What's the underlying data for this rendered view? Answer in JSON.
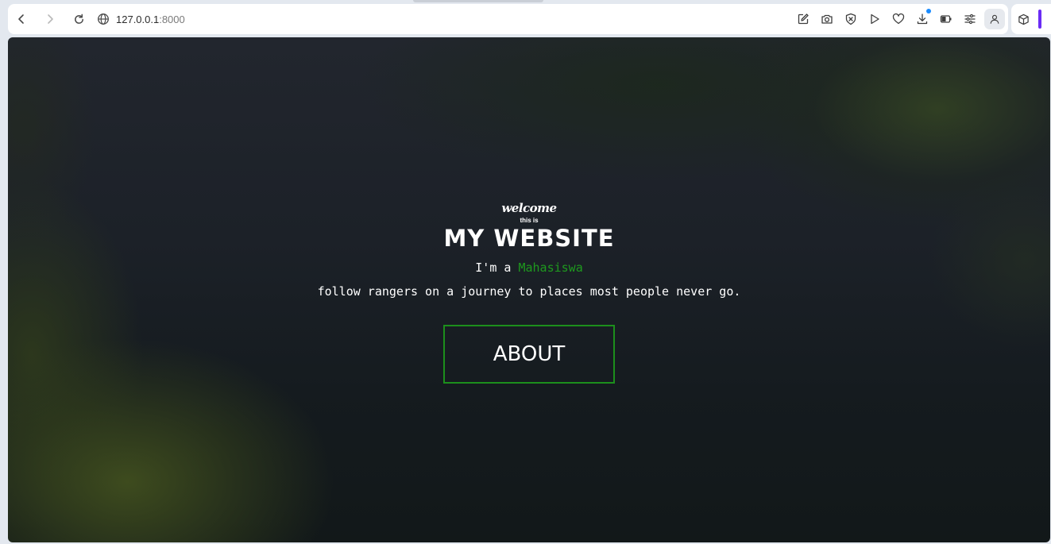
{
  "browser": {
    "url_host": "127.0.0.1",
    "url_port": ":8000",
    "icons": {
      "back": "back-arrow-icon",
      "forward": "forward-arrow-icon",
      "reload": "reload-icon",
      "site_info": "globe-icon",
      "toolbar_right": [
        "edit-icon",
        "camera-icon",
        "shield-icon",
        "play-icon",
        "heart-icon",
        "download-icon",
        "battery-icon",
        "sliders-icon",
        "profile-icon"
      ],
      "side_panel": "cube-icon"
    },
    "accent_color": "#6b2cf5",
    "download_badge_color": "#1a8cff"
  },
  "hero": {
    "welcome": "welcome",
    "this_is": "this is",
    "title": "MY WEBSITE",
    "intro_prefix": "I'm a ",
    "intro_role": "Mahasiswa",
    "tagline": "follow rangers on a journey to places most people never go.",
    "about_button": "ABOUT",
    "role_color": "#1e9a1e",
    "button_border_color": "#1c8f1c"
  }
}
